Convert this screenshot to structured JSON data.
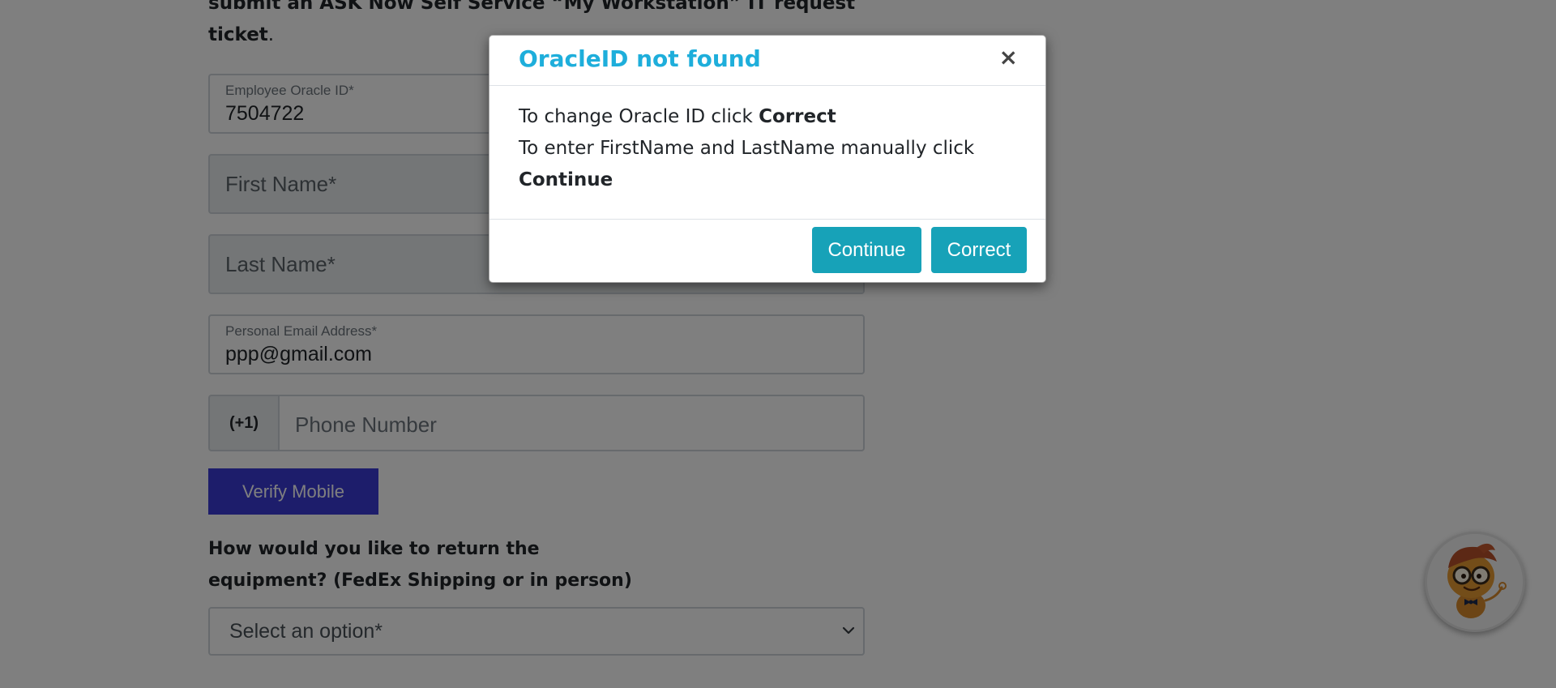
{
  "page": {
    "intro_line1": "submit an ASK Now Self Service “My Workstation” IT request",
    "intro_line2": "ticket",
    "intro_period": "."
  },
  "form": {
    "oracle_id": {
      "label": "Employee Oracle ID*",
      "value": "7504722"
    },
    "first_name": {
      "placeholder": "First Name*"
    },
    "last_name": {
      "placeholder": "Last Name*"
    },
    "email": {
      "label": "Personal Email Address*",
      "value": "ppp@gmail.com"
    },
    "phone": {
      "prefix": "(+1)",
      "placeholder": "Phone Number"
    },
    "verify_button": "Verify Mobile",
    "return_question_line1": "How would you like to return the",
    "return_question_line2": "equipment? (FedEx Shipping or in person)",
    "return_select": {
      "placeholder": "Select an option*"
    }
  },
  "modal": {
    "title": "OracleID not found",
    "close_symbol": "×",
    "line1_text": "To change Oracle ID click ",
    "line1_bold": "Correct",
    "line2_text": "To enter FirstName and LastName manually click ",
    "line2_bold": "Continue",
    "continue_button": "Continue",
    "correct_button": "Correct"
  },
  "colors": {
    "modal_title": "#1eaedb",
    "modal_button": "#17a2b8",
    "verify_button": "#3b3bd6",
    "backdrop": "rgba(0,0,0,0.5)"
  },
  "icons": {
    "close": "close-icon",
    "select_chevron": "chevron-down-icon",
    "chat_assistant": "chat-assistant-avatar-icon"
  }
}
